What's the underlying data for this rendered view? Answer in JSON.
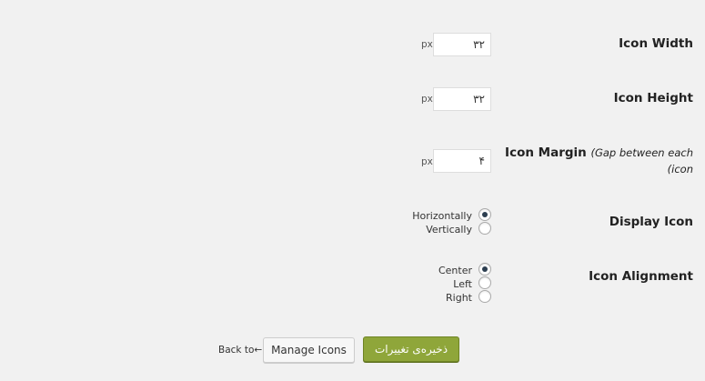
{
  "fields": {
    "icon_width": {
      "label": "Icon Width",
      "value": "۳۲",
      "unit": "px"
    },
    "icon_height": {
      "label": "Icon Height",
      "value": "۳۲",
      "unit": "px"
    },
    "icon_margin": {
      "label": "Icon Margin",
      "note_line1": "(Gap between each",
      "note_line2": "(icon",
      "value": "۴",
      "unit": "px"
    }
  },
  "display_icon": {
    "label": "Display Icon",
    "options": [
      {
        "label": "Horizontally",
        "checked": true
      },
      {
        "label": "Vertically",
        "checked": false
      }
    ]
  },
  "icon_alignment": {
    "label": "Icon Alignment",
    "options": [
      {
        "label": "Center",
        "checked": true
      },
      {
        "label": "Left",
        "checked": false
      },
      {
        "label": "Right",
        "checked": false
      }
    ]
  },
  "footer": {
    "back_text": "Back to",
    "back_arrow": "←",
    "manage_button": "Manage Icons",
    "save_button": "ذخیره‌ی تغییرات"
  },
  "colors": {
    "background": "#f1f1f1",
    "save_button_bg": "#8fa63a",
    "radio_dot": "#2c3e50"
  }
}
